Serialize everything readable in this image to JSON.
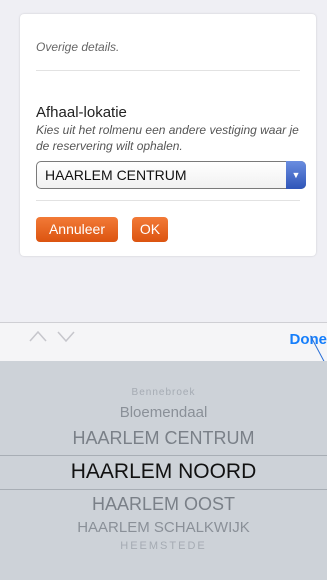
{
  "form": {
    "note": "Overige details.",
    "pickup_title": "Afhaal-lokatie",
    "pickup_help": "Kies uit het rolmenu een andere vestiging waar je de reservering wilt ophalen.",
    "selected_location": "HAARLEM CENTRUM",
    "cancel_label": "Annuleer",
    "ok_label": "OK"
  },
  "toolbar": {
    "prev_icon": "chevron-up-icon",
    "next_icon": "chevron-down-icon",
    "done_label": "Done"
  },
  "picker": {
    "options": [
      "Bennebroek",
      "Bloemendaal",
      "HAARLEM CENTRUM",
      "HAARLEM NOORD",
      "HAARLEM OOST",
      "HAARLEM SCHALKWIJK",
      "HEEMSTEDE"
    ],
    "selected": "HAARLEM NOORD"
  },
  "colors": {
    "accent": "#157efb",
    "button": "#e8631f",
    "picker_bg": "#cdd2d8",
    "page_bg": "#efeff4"
  }
}
